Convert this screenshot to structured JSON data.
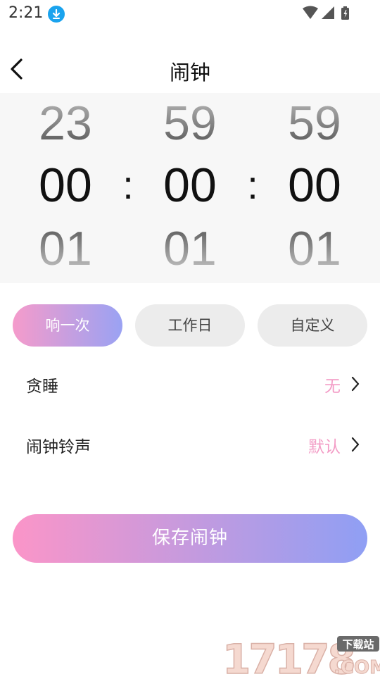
{
  "status_bar": {
    "time": "2:21"
  },
  "header": {
    "title": "闹钟"
  },
  "picker": {
    "hours": {
      "prev": "23",
      "current": "00",
      "next": "01"
    },
    "minutes": {
      "prev": "59",
      "current": "00",
      "next": "01"
    },
    "seconds": {
      "prev": "59",
      "current": "00",
      "next": "01"
    },
    "separator": ":"
  },
  "repeat_options": [
    {
      "label": "响一次",
      "selected": true
    },
    {
      "label": "工作日",
      "selected": false
    },
    {
      "label": "自定义",
      "selected": false
    }
  ],
  "settings": {
    "snooze": {
      "label": "贪睡",
      "value": "无"
    },
    "ringtone": {
      "label": "闹钟铃声",
      "value": "默认"
    }
  },
  "save_button": {
    "label": "保存闹钟"
  },
  "watermark": {
    "text": "17178",
    "badge": "下载站",
    "suffix": ".COM"
  },
  "colors": {
    "accent_pink": "#f59bcb",
    "accent_blue": "#9aa2f3",
    "value_pink": "#f39cc6",
    "status_blue": "#1aa3ee"
  }
}
